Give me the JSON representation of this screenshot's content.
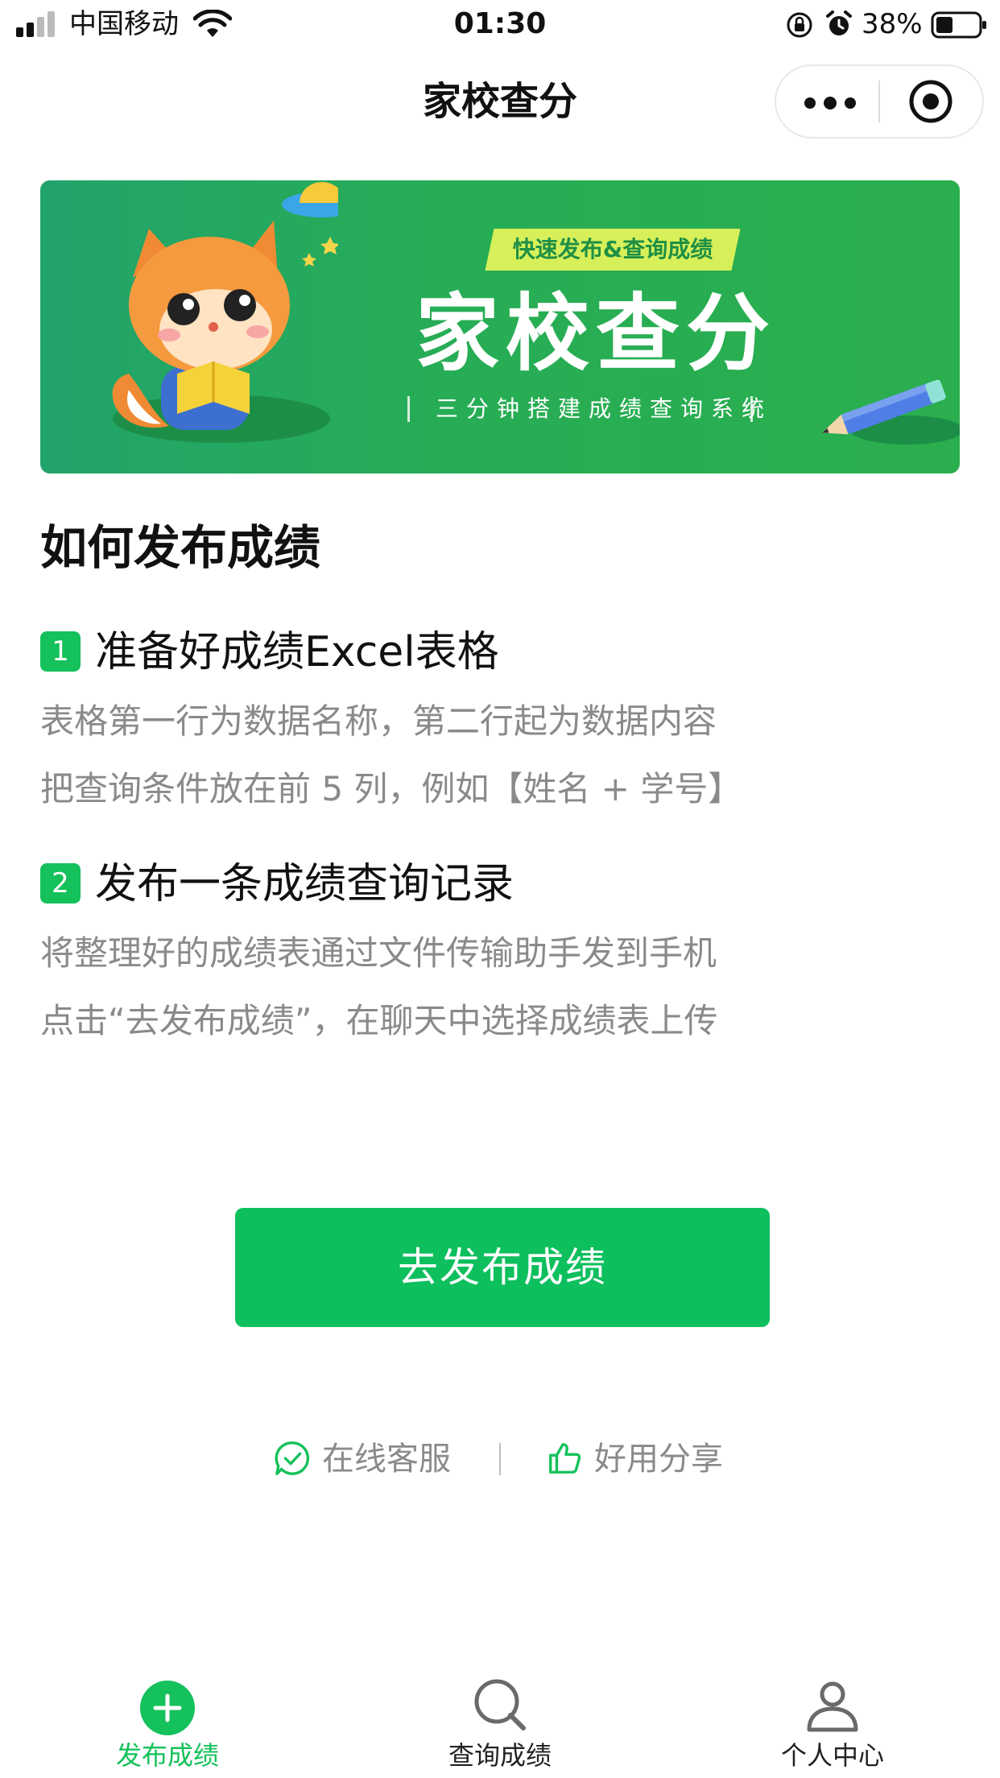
{
  "status_bar": {
    "carrier": "中国移动",
    "time": "01:30",
    "battery": "38%"
  },
  "nav": {
    "title": "家校查分"
  },
  "banner": {
    "tag": "快速发布&查询成绩",
    "title": "家校查分",
    "subtitle": "三分钟搭建成绩查询系统"
  },
  "guide": {
    "title": "如何发布成绩",
    "steps": [
      {
        "number": "1",
        "title": "准备好成绩Excel表格",
        "lines": [
          "表格第一行为数据名称，第二行起为数据内容",
          "把查询条件放在前 5 列，例如【姓名 + 学号】"
        ]
      },
      {
        "number": "2",
        "title": "发布一条成绩查询记录",
        "lines": [
          "将整理好的成绩表通过文件传输助手发到手机",
          "点击“去发布成绩”，在聊天中选择成绩表上传"
        ]
      }
    ]
  },
  "primary_button": "去发布成绩",
  "links": {
    "service": "在线客服",
    "share": "好用分享"
  },
  "tabs": [
    {
      "label": "发布成绩",
      "icon": "plus-circle-icon",
      "active": true
    },
    {
      "label": "查询成绩",
      "icon": "search-icon",
      "active": false
    },
    {
      "label": "个人中心",
      "icon": "person-icon",
      "active": false
    }
  ],
  "colors": {
    "accent": "#0dbf5d",
    "banner": "#27ad55",
    "muted_text": "#8a8a8a"
  }
}
